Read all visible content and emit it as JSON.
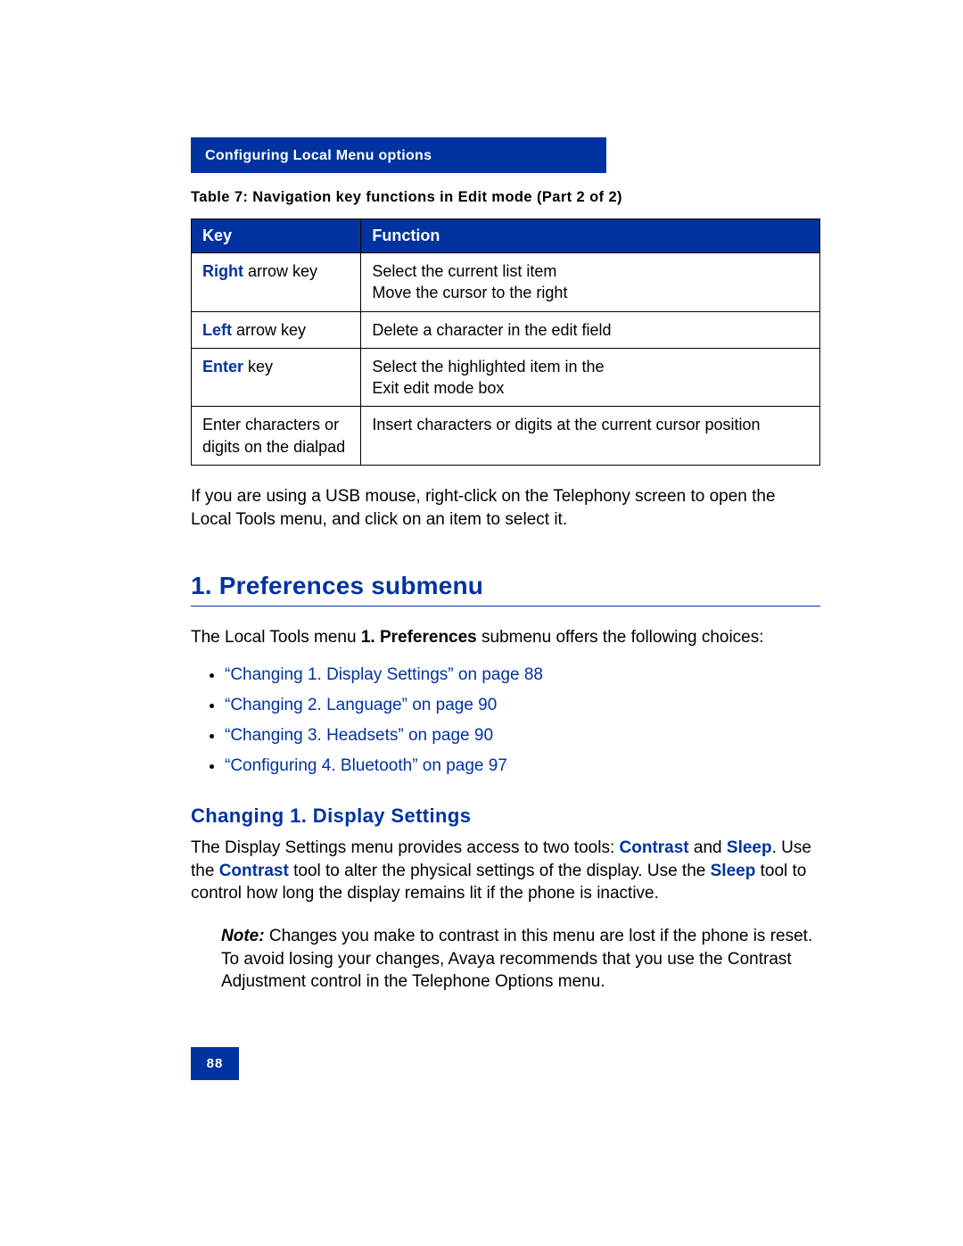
{
  "header": {
    "title": "Configuring Local Menu options"
  },
  "table": {
    "caption": "Table 7: Navigation key functions in Edit mode (Part 2 of 2)",
    "headers": {
      "col1": "Key",
      "col2": "Function"
    },
    "rows": [
      {
        "key_prefix": "Right",
        "key_suffix": " arrow key",
        "key_plain": "",
        "func_line1": "Select the current list item",
        "func_line2": "Move the cursor to the right"
      },
      {
        "key_prefix": "Left",
        "key_suffix": " arrow key",
        "key_plain": "",
        "func_line1": "Delete a character in the edit field",
        "func_line2": ""
      },
      {
        "key_prefix": "Enter",
        "key_suffix": " key",
        "key_plain": "",
        "func_line1": "Select the highlighted item in the",
        "func_line2": "Exit edit mode box"
      },
      {
        "key_prefix": "",
        "key_suffix": "",
        "key_plain": "Enter characters or digits on the dialpad",
        "func_line1": "Insert characters or digits at the current cursor position",
        "func_line2": ""
      }
    ]
  },
  "para_after_table": "If you are using a USB mouse, right-click on the Telephony screen to open the Local Tools menu, and click on an item to select it.",
  "section": {
    "title": "1. Preferences submenu"
  },
  "intro": {
    "pre": "The Local Tools menu ",
    "bold": "1. Preferences",
    "post": " submenu offers the following choices:"
  },
  "links": [
    "“Changing 1. Display Settings” on page 88",
    "“Changing 2. Language” on page 90",
    "“Changing 3. Headsets” on page 90",
    "“Configuring 4. Bluetooth” on page 97"
  ],
  "subsection": {
    "title": "Changing 1. Display Settings"
  },
  "display_paragraph": {
    "t1": "The Display Settings menu provides access to two tools: ",
    "b1": "Contrast",
    "t2": " and ",
    "b2": "Sleep",
    "t3": ". Use the ",
    "b3": "Contrast",
    "t4": " tool to alter the physical settings of the display. Use the ",
    "b4": "Sleep",
    "t5": " tool to control how long the display remains lit if the phone is inactive."
  },
  "note": {
    "label": "Note:",
    "text": " Changes you make to contrast in this menu are lost if the phone is reset. To avoid losing your changes, Avaya recommends that you use the Contrast Adjustment control in the Telephone Options menu."
  },
  "footer": {
    "page": "88"
  }
}
